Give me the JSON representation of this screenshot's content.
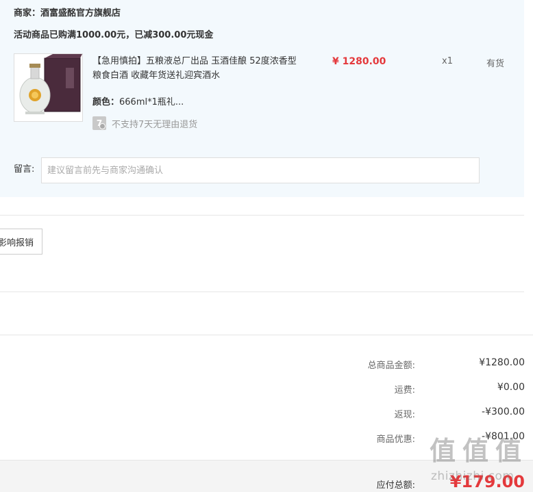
{
  "seller": {
    "label": "商家：",
    "name": "酒富盛酩官方旗舰店"
  },
  "promo": {
    "text": "活动商品已购满1000.00元，已减300.00元现金"
  },
  "item": {
    "title": "【急用慎拍】五粮液总厂出品 玉酒佳酿 52度浓香型粮食白酒 收藏年货送礼迎宾酒水",
    "price": "¥ 1280.00",
    "quantity": "x1",
    "stock": "有货",
    "attr_label": "颜色：",
    "attr_value": "666ml*1瓶礼...",
    "return_icon_char": "7",
    "return_policy": "不支持7天无理由退货",
    "image_icon": "liquor-bottle-gift-box"
  },
  "note": {
    "label": "留言:",
    "placeholder": "建议留言前先与商家沟通确认"
  },
  "invoice": {
    "button_label": "影响报销"
  },
  "summary": {
    "goods_total_label": "总商品金额:",
    "goods_total": "¥1280.00",
    "shipping_label": "运费:",
    "shipping": "¥0.00",
    "cashback_label": "返现:",
    "cashback": "-¥300.00",
    "discount_label": "商品优惠:",
    "discount": "-¥801.00",
    "payable_label": "应付总额:",
    "payable": "¥179.00"
  },
  "watermark": {
    "glyphs": [
      "值",
      "值",
      "值"
    ],
    "text": "zhizhizhi.com"
  },
  "colors": {
    "accent": "#e4393c",
    "panel_bg": "#f3f9fd"
  }
}
